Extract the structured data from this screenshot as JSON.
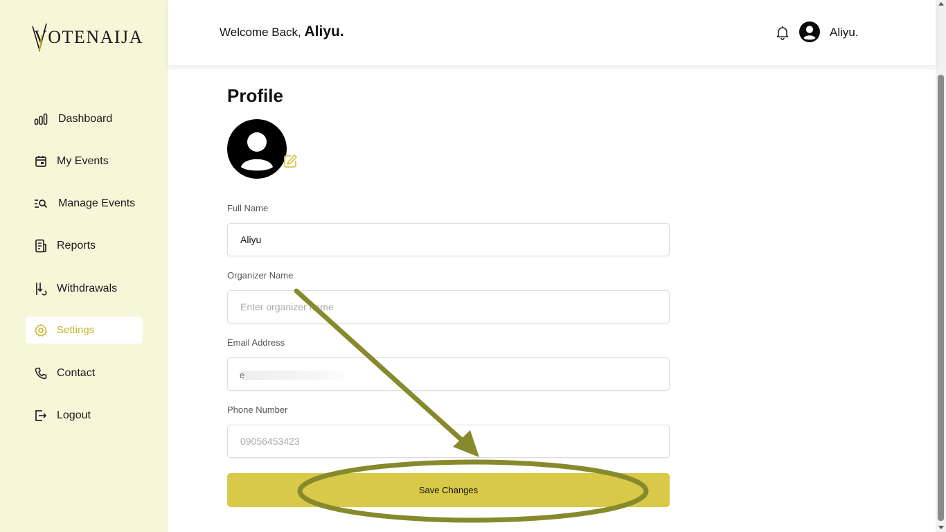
{
  "app": {
    "logo_text": "VOTENAIJA",
    "brand_color": "#d9c948",
    "accent_text_color": "#c9b227",
    "sidebar_bg": "#f6f7d9"
  },
  "sidebar": {
    "items": [
      {
        "label": "Dashboard",
        "icon": "bar-chart-icon",
        "active": false
      },
      {
        "label": "My Events",
        "icon": "calendar-icon",
        "active": false
      },
      {
        "label": "Manage Events",
        "icon": "search-list-icon",
        "active": false
      },
      {
        "label": "Reports",
        "icon": "report-icon",
        "active": false
      },
      {
        "label": "Withdrawals",
        "icon": "withdraw-icon",
        "active": false
      },
      {
        "label": "Settings",
        "icon": "gear-icon",
        "active": true
      },
      {
        "label": "Contact",
        "icon": "phone-icon",
        "active": false
      },
      {
        "label": "Logout",
        "icon": "logout-icon",
        "active": false
      }
    ]
  },
  "header": {
    "welcome_prefix": "Welcome Back,",
    "welcome_name": "Aliyu.",
    "user_name": "Aliyu."
  },
  "main": {
    "title": "Profile",
    "fields": {
      "full_name": {
        "label": "Full Name",
        "value": "Aliyu",
        "placeholder": ""
      },
      "organizer_name": {
        "label": "Organizer Name",
        "value": "",
        "placeholder": "Enter organizer name"
      },
      "email": {
        "label": "Email Address",
        "value": "",
        "visible_fragment": "e"
      },
      "phone": {
        "label": "Phone Number",
        "value": "",
        "placeholder": "09056453423"
      }
    },
    "save_label": "Save Changes"
  },
  "annotation": {
    "color": "#878a2c",
    "shapes": [
      "arrow",
      "ellipse"
    ]
  }
}
